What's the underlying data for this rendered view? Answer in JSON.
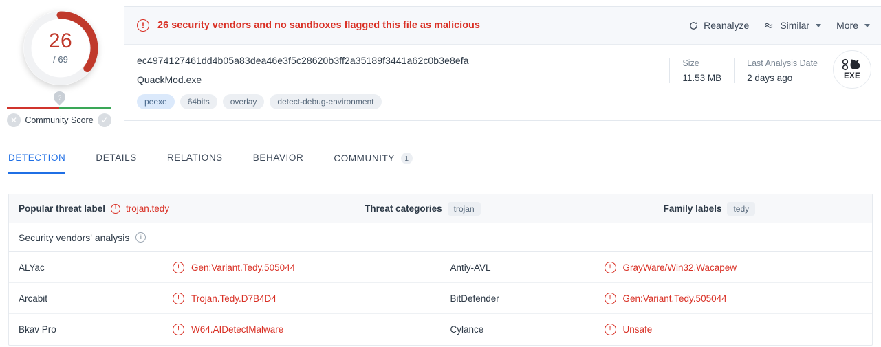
{
  "score": {
    "detections": "26",
    "total": "/ 69",
    "community_label": "Community Score",
    "pin_glyph": "?",
    "negative_icon": "close-icon",
    "positive_icon": "check-icon",
    "arc_color": "#c0392b",
    "bar_left_color": "#d0342c",
    "bar_right_color": "#3aa757"
  },
  "banner": {
    "alert_glyph": "!",
    "message": "26 security vendors and no sandboxes flagged this file as malicious",
    "color": "#d93025",
    "actions": [
      {
        "label": "Reanalyze",
        "icon": "refresh-icon",
        "caret": false
      },
      {
        "label": "Similar",
        "icon": "approx-wave-icon",
        "caret": true
      },
      {
        "label": "More",
        "icon": "",
        "caret": true
      }
    ]
  },
  "file": {
    "hash": "ec4974127461dd4b05a83dea46e3f5c28620b3ff2a35189f3441a62c0b3e8efa",
    "name": "QuackMod.exe",
    "tags": [
      {
        "label": "peexe",
        "style": "blue"
      },
      {
        "label": "64bits",
        "style": "gray"
      },
      {
        "label": "overlay",
        "style": "gray"
      },
      {
        "label": "detect-debug-environment",
        "style": "gray"
      }
    ],
    "size_label": "Size",
    "size_value": "11.53 MB",
    "date_label": "Last Analysis Date",
    "date_value": "2 days ago",
    "type_badge": "EXE"
  },
  "tabs": [
    {
      "label": "DETECTION",
      "active": true,
      "badge": ""
    },
    {
      "label": "DETAILS",
      "active": false,
      "badge": ""
    },
    {
      "label": "RELATIONS",
      "active": false,
      "badge": ""
    },
    {
      "label": "BEHAVIOR",
      "active": false,
      "badge": ""
    },
    {
      "label": "COMMUNITY",
      "active": false,
      "badge": "1"
    }
  ],
  "threat": {
    "popular_label_key": "Popular threat label",
    "popular_label_value": "trojan.tedy",
    "categories_key": "Threat categories",
    "categories_value": "trojan",
    "family_key": "Family labels",
    "family_value": "tedy"
  },
  "vendors_section": {
    "title": "Security vendors' analysis",
    "info_glyph": "i"
  },
  "vendors": [
    {
      "name": "ALYac",
      "result": "Gen:Variant.Tedy.505044"
    },
    {
      "name": "Antiy-AVL",
      "result": "GrayWare/Win32.Wacapew"
    },
    {
      "name": "Arcabit",
      "result": "Trojan.Tedy.D7B4D4"
    },
    {
      "name": "BitDefender",
      "result": "Gen:Variant.Tedy.505044"
    },
    {
      "name": "Bkav Pro",
      "result": "W64.AIDetectMalware"
    },
    {
      "name": "Cylance",
      "result": "Unsafe"
    }
  ]
}
